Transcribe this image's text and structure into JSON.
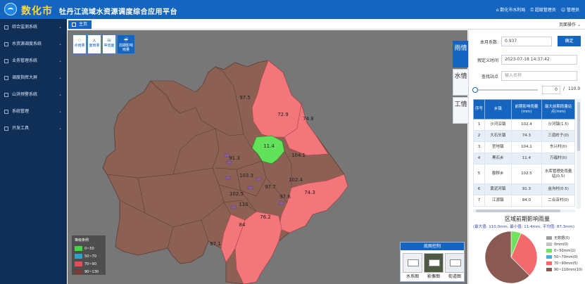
{
  "header": {
    "brand": "数化市",
    "title": "牡丹江流域水资源调度综合应用平台",
    "org": "数化市水利局",
    "change_password": "超级管理员",
    "user": "管理员"
  },
  "sidebar": {
    "items": [
      {
        "label": "综合监测系统"
      },
      {
        "label": "水资源调度系统"
      },
      {
        "label": "业务管理系统"
      },
      {
        "label": "调度指挥大屏"
      },
      {
        "label": "山洪预警系统"
      },
      {
        "label": "系统管理"
      },
      {
        "label": "开发工具"
      }
    ]
  },
  "tabs": {
    "home": "主页",
    "page_ops": "页面操作"
  },
  "map_tools": [
    {
      "label": "点雨量",
      "icon": "rain-point-icon"
    },
    {
      "label": "面雨量",
      "icon": "area-rain-icon"
    },
    {
      "label": "等值面",
      "icon": "isoline-icon"
    },
    {
      "label": "前期影响雨量",
      "icon": "antecedent-rain-icon"
    }
  ],
  "map": {
    "region_values": [
      "97.5",
      "72.9",
      "74.8",
      "11.4",
      "104.1",
      "91.3",
      "103.3",
      "102.4",
      "97.7",
      "102.5",
      "97.6",
      "74.3",
      "110",
      "76.2",
      "84",
      "87.1"
    ],
    "colors": {
      "green": "#62e25a",
      "red": "#f3767b",
      "brown": "#8c6154",
      "grey": "#777777"
    }
  },
  "legend": {
    "title": "等级条例",
    "items": [
      {
        "label": "0~50",
        "color": "#43d643"
      },
      {
        "label": "50~70",
        "color": "#2fa2c9"
      },
      {
        "label": "70~90",
        "color": "#e84a5a"
      },
      {
        "label": "90~130",
        "color": "#7a3b36"
      }
    ]
  },
  "basemap": {
    "title": "底图控制",
    "items": [
      {
        "label": "水系图"
      },
      {
        "label": "影像图"
      },
      {
        "label": "街道图"
      }
    ]
  },
  "side_tabs": [
    "雨情",
    "水情",
    "工情"
  ],
  "panel": {
    "coef_label": "本月系数:",
    "coef_value": "0.937",
    "confirm": "确定",
    "time_label": "假定义时间",
    "time_value": "2023-07-18 14:37:42",
    "search_label": "查找站点",
    "search_placeholder": "输入名称",
    "slider_value": "0",
    "slider_sep": "/",
    "slider_max": "110.0",
    "slider_fraction": 0.0
  },
  "table": {
    "headers": [
      "序号",
      "乡镇",
      "前期影响雨量(mm)",
      "最大前期雨量站点(mm)"
    ],
    "rows": [
      [
        "1",
        "沙河沿镇",
        "102.4",
        "沙河镇(1.5)"
      ],
      [
        "2",
        "大石头镇",
        "74.3",
        "三道岭子(0)"
      ],
      [
        "3",
        "官地镇",
        "104.1",
        "东兴村(0)"
      ],
      [
        "4",
        "黑石乡",
        "11.4",
        "万福村(0)"
      ],
      [
        "5",
        "额穆乡",
        "102.5",
        "水库管理处雨量站(0.5)"
      ],
      [
        "6",
        "黄泥河镇",
        "91.3",
        "金沟村(0.5)"
      ],
      [
        "7",
        "江源镇",
        "84.0",
        "二合店村(0)"
      ]
    ]
  },
  "chart_data": {
    "type": "pie",
    "title": "区域前期影响雨量",
    "subtitle": "(最大值: 110.0mm, 最小值: 11.4mm, 平均值: 87.3mm)",
    "categories": [
      "无数据",
      "0mm",
      "0~50mm",
      "50~70mm",
      "70~90mm",
      "90~110mm"
    ],
    "values": [
      0,
      0,
      1,
      0,
      5,
      10
    ],
    "legend_labels": [
      "无数据(0)",
      "0mm(0)",
      "0~50mm(1)",
      "50~70mm(0)",
      "70~90mm(5)",
      "90~110mm(10)"
    ],
    "colors": [
      "#9e9e9e",
      "#c4c4c4",
      "#6ee45c",
      "#3fb2e0",
      "#f36a6d",
      "#8a5a52"
    ],
    "legend_position": "right"
  }
}
